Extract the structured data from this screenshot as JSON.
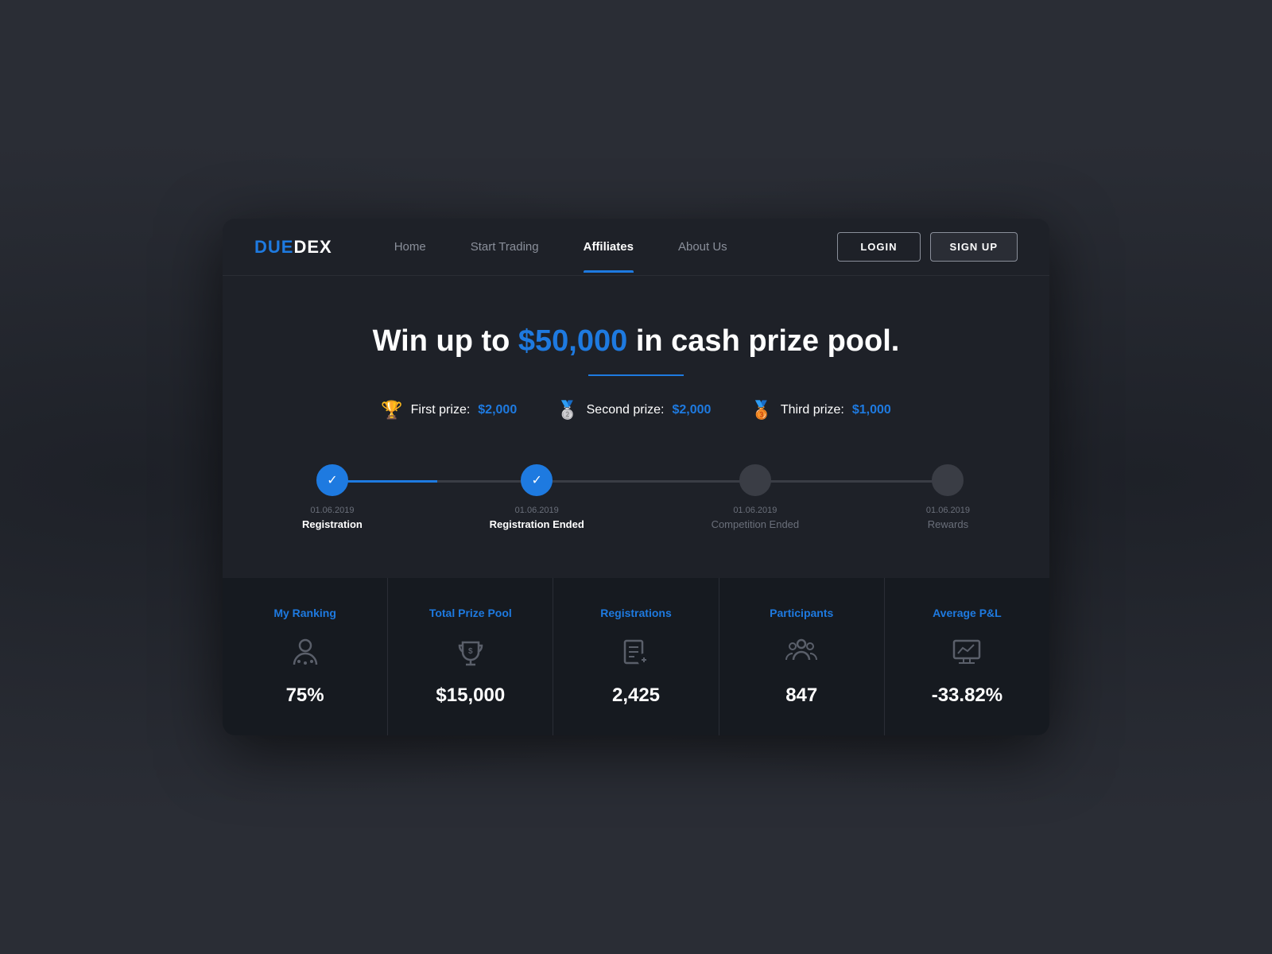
{
  "logo": {
    "part1": "DUE",
    "part2": "DEX"
  },
  "navbar": {
    "links": [
      {
        "label": "Home",
        "active": false
      },
      {
        "label": "Start Trading",
        "active": false
      },
      {
        "label": "Affiliates",
        "active": true
      },
      {
        "label": "About Us",
        "active": false
      }
    ],
    "login_label": "LOGIN",
    "signup_label": "SIGN UP"
  },
  "hero": {
    "title_before": "Win up to ",
    "title_amount": "$50,000",
    "title_after": " in cash prize pool.",
    "prizes": [
      {
        "icon": "🏆",
        "label": "First prize:",
        "amount": "$2,000"
      },
      {
        "icon": "🥈",
        "label": "Second prize:",
        "amount": "$2,000"
      },
      {
        "icon": "🥉",
        "label": "Third prize:",
        "amount": "$1,000"
      }
    ]
  },
  "timeline": {
    "nodes": [
      {
        "date": "01.06.2019",
        "label": "Registration",
        "completed": true
      },
      {
        "date": "01.06.2019",
        "label": "Registration Ended",
        "completed": true
      },
      {
        "date": "01.06.2019",
        "label": "Competition Ended",
        "completed": false
      },
      {
        "date": "01.06.2019",
        "label": "Rewards",
        "completed": false
      }
    ]
  },
  "stats": [
    {
      "label": "My Ranking",
      "value": "75%",
      "icon": "ranking"
    },
    {
      "label": "Total Prize Pool",
      "value": "$15,000",
      "icon": "prize"
    },
    {
      "label": "Registrations",
      "value": "2,425",
      "icon": "registrations"
    },
    {
      "label": "Participants",
      "value": "847",
      "icon": "participants"
    },
    {
      "label": "Average P&L",
      "value": "-33.82%",
      "icon": "chart"
    }
  ]
}
